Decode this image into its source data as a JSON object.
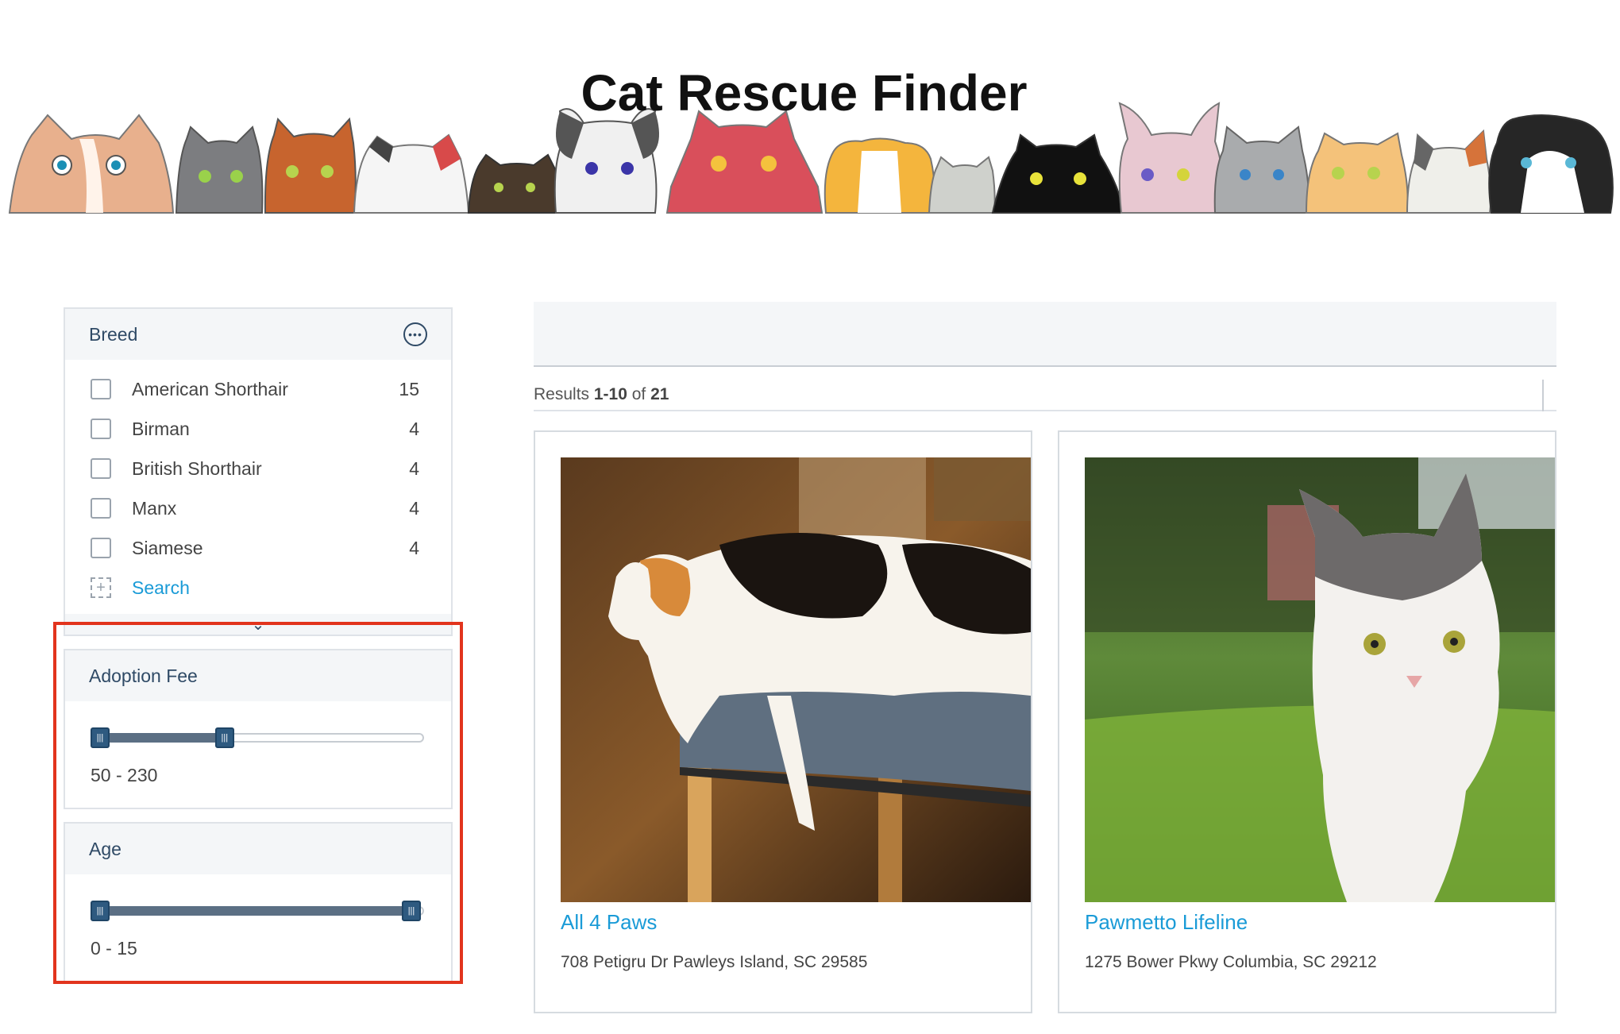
{
  "header": {
    "title": "Cat Rescue Finder"
  },
  "filters": {
    "breed": {
      "title": "Breed",
      "more_icon": "ellipsis-circle-icon",
      "items": [
        {
          "label": "American Shorthair",
          "count": "15",
          "checked": false
        },
        {
          "label": "Birman",
          "count": "4",
          "checked": false
        },
        {
          "label": "British Shorthair",
          "count": "4",
          "checked": false
        },
        {
          "label": "Manx",
          "count": "4",
          "checked": false
        },
        {
          "label": "Siamese",
          "count": "4",
          "checked": false
        }
      ],
      "search_label": "Search",
      "expand_icon": "chevron-down-icon"
    },
    "adoption_fee": {
      "title": "Adoption Fee",
      "range_text": "50 - 230",
      "min_handle_fraction": 0.0,
      "max_handle_fraction": 0.4
    },
    "age": {
      "title": "Age",
      "range_text": "0 - 15",
      "min_handle_fraction": 0.0,
      "max_handle_fraction": 1.0
    }
  },
  "results": {
    "prefix": "Results ",
    "range": "1-10",
    "of": " of ",
    "total": "21"
  },
  "cards": [
    {
      "name": "All 4 Paws",
      "address": "708 Petigru Dr Pawleys Island, SC 29585",
      "photo": "calico-cat-photo"
    },
    {
      "name": "Pawmetto Lifeline",
      "address": "1275 Bower Pkwy Columbia, SC 29212",
      "photo": "gray-white-kitten-photo"
    }
  ],
  "colors": {
    "link": "#1a9bd7",
    "facet_header_bg": "#f4f6f8",
    "slider_thumb": "#2e5a80",
    "highlight": "#e2341d"
  }
}
